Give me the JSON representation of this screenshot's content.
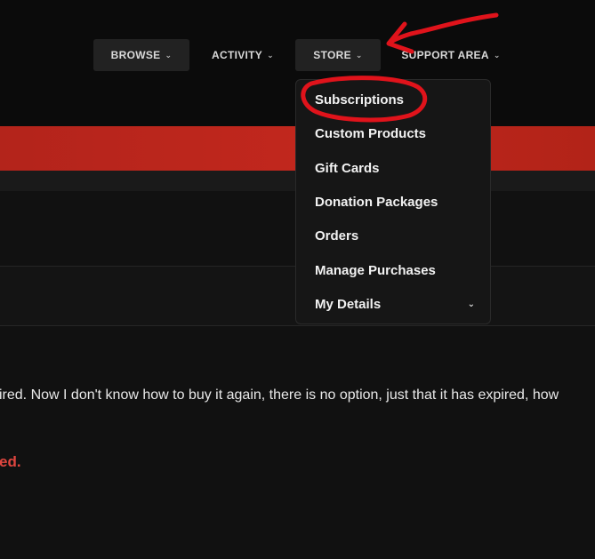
{
  "nav": {
    "items": [
      {
        "label": "BROWSE"
      },
      {
        "label": "ACTIVITY"
      },
      {
        "label": "STORE"
      },
      {
        "label": "SUPPORT AREA"
      }
    ]
  },
  "store_menu": {
    "items": [
      {
        "label": "Subscriptions"
      },
      {
        "label": "Custom Products"
      },
      {
        "label": "Gift Cards"
      },
      {
        "label": "Donation Packages"
      },
      {
        "label": "Orders"
      },
      {
        "label": "Manage Purchases"
      },
      {
        "label": "My Details"
      }
    ]
  },
  "post": {
    "text": "ired. Now I don't know how to buy it again, there is no option, just that it has expired, how",
    "highlight": "ed."
  },
  "colors": {
    "banner": "#c1271d",
    "annotation": "#e0131b",
    "highlight_text": "#e0463f"
  },
  "icons": {
    "nav_caret": "chevron-down-icon",
    "details_caret": "chevron-down-icon"
  }
}
